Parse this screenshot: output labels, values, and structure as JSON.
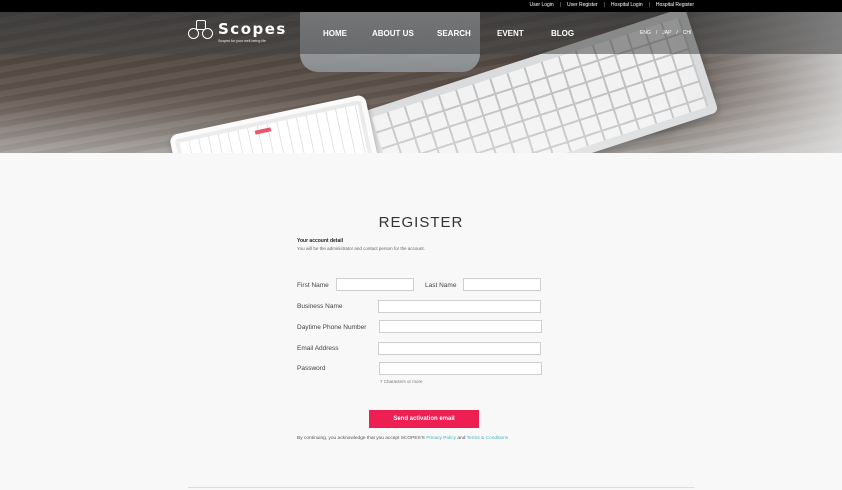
{
  "top_links": [
    "User Login",
    "User Register",
    "Hospital Login",
    "Hospital Register"
  ],
  "logo": {
    "brand": "Scopes",
    "tagline": "Scopes for your well-being life"
  },
  "nav": [
    "HOME",
    "ABOUT US",
    "SEARCH",
    "EVENT",
    "BLOG"
  ],
  "lang": {
    "eng": "ENG",
    "jap": "JAP",
    "chi": "CHI",
    "sep": "/"
  },
  "register": {
    "title": "REGISTER",
    "account_heading": "Your account detail",
    "account_desc": "You will be the administrator and contact person for the account.",
    "first_name_label": "First Name",
    "last_name_label": "Last Name",
    "business_label": "Business Name",
    "phone_label": "Daytime Phone Number",
    "email_label": "Email Address",
    "password_label": "Password",
    "password_hint": "7 Characters or more",
    "submit": "Send activation email",
    "terms_prefix": "By continuing, you acknowledge that you accept SCOPES'S",
    "privacy": "Privacy Policy",
    "and": "and",
    "terms": "Terms & Conditions"
  },
  "colors": {
    "accent": "#ee1f52",
    "link": "#4db3c0"
  }
}
